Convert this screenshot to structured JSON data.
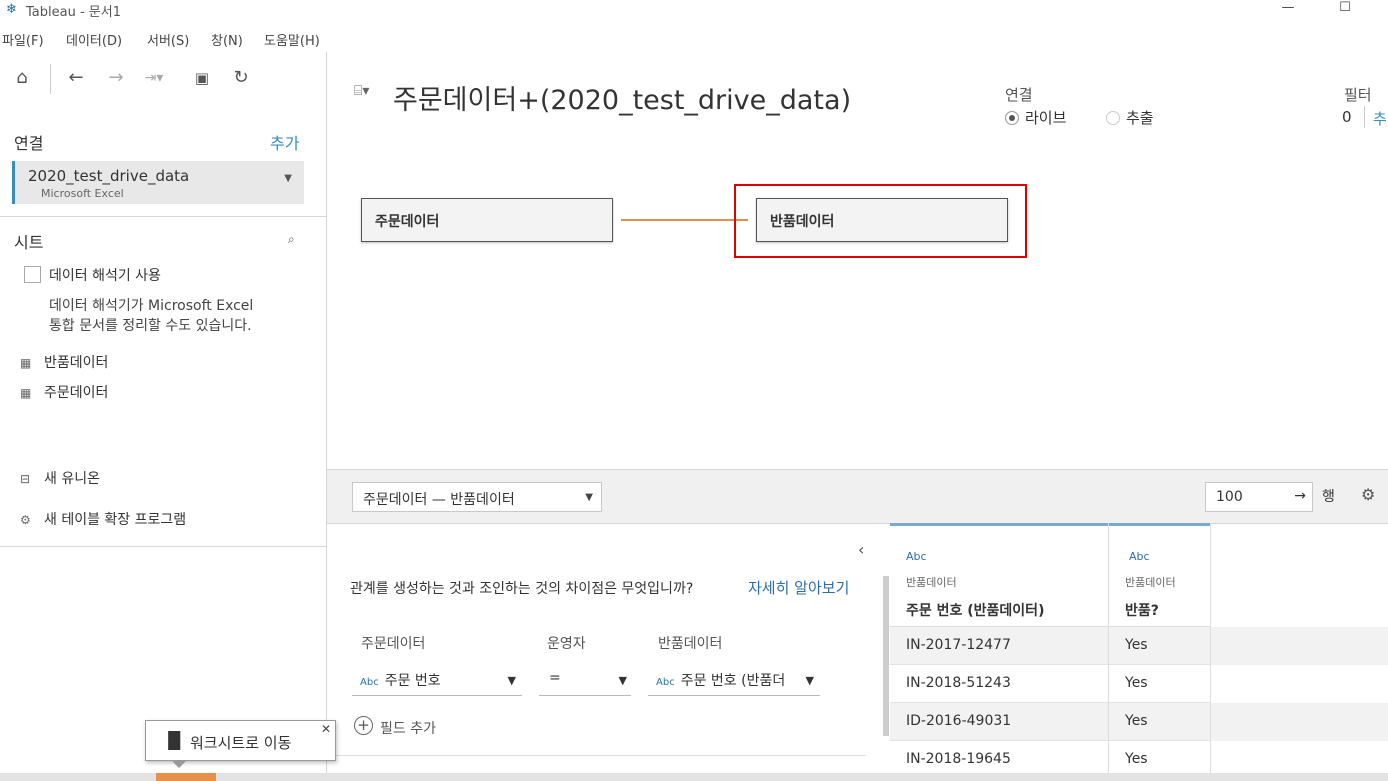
{
  "window": {
    "title": "Tableau - 문서1",
    "app_icon": "tableau-logo-icon"
  },
  "menu": [
    "파일(F)",
    "데이터(D)",
    "서버(S)",
    "창(N)",
    "도움말(H)"
  ],
  "toolbar": {
    "icons": [
      "home-icon",
      "back-icon",
      "forward-icon",
      "redo-icon",
      "save-icon",
      "refresh-icon"
    ]
  },
  "connections": {
    "title": "연결",
    "add_label": "추가",
    "item": {
      "name": "2020_test_drive_data",
      "type": "Microsoft Excel"
    }
  },
  "sheets": {
    "title": "시트",
    "interpreter_label": "데이터 해석기 사용",
    "interpreter_desc_1": "데이터 해석기가 Microsoft Excel",
    "interpreter_desc_2": "통합 문서를 정리할 수도 있습니다.",
    "items": [
      "반품데이터",
      "주문데이터"
    ],
    "new_union": "새 유니온",
    "new_extension": "새 테이블 확장 프로그램"
  },
  "datasource": {
    "title": "주문데이터+(2020_test_drive_data)",
    "connection_label": "연결",
    "live_label": "라이브",
    "extract_label": "추출",
    "filter_label": "필터",
    "filter_count": "0",
    "filter_add": "추"
  },
  "canvas": {
    "left_table": "주문데이터",
    "right_table": "반품데이터"
  },
  "relationship": {
    "selector": "주문데이터 — 반품데이터",
    "rows_value": "100",
    "rows_label": "행",
    "question": "관계를 생성하는 것과 조인하는 것의 차이점은 무엇입니까?",
    "learn_more": "자세히 알아보기",
    "col_left": "주문데이터",
    "col_op": "운영자",
    "col_right": "반품데이터",
    "left_field": "주문 번호",
    "operator": "=",
    "right_field": "주문 번호 (반품더",
    "add_field": "필드 추가",
    "abc": "Abc"
  },
  "grid": {
    "columns": [
      {
        "type": "Abc",
        "source": "반품데이터",
        "name": "주문 번호 (반품데이터)"
      },
      {
        "type": "Abc",
        "source": "반품데이터",
        "name": "반품?"
      }
    ],
    "rows": [
      [
        "IN-2017-12477",
        "Yes"
      ],
      [
        "IN-2018-51243",
        "Yes"
      ],
      [
        "ID-2016-49031",
        "Yes"
      ],
      [
        "IN-2018-19645",
        "Yes"
      ]
    ]
  },
  "tooltip": {
    "text": "워크시트로 이동"
  }
}
